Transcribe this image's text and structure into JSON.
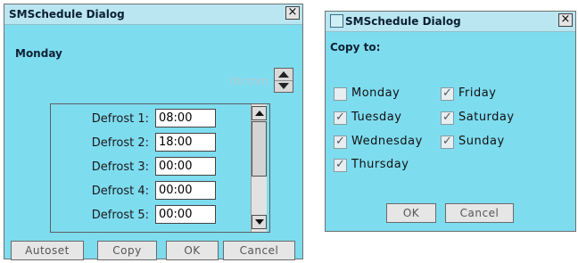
{
  "dialog1": {
    "title": "SMSchedule Dialog",
    "close_glyph": "×",
    "heading": "Monday",
    "time_format_hint": "hh:mm",
    "rows": [
      {
        "label": "Defrost 1:",
        "value": "08:00"
      },
      {
        "label": "Defrost 2:",
        "value": "18:00"
      },
      {
        "label": "Defrost 3:",
        "value": "00:00"
      },
      {
        "label": "Defrost 4:",
        "value": "00:00"
      },
      {
        "label": "Defrost 5:",
        "value": "00:00"
      }
    ],
    "buttons": {
      "autoset": "Autoset",
      "copy": "Copy",
      "ok": "OK",
      "cancel": "Cancel"
    }
  },
  "dialog2": {
    "title": "SMSchedule Dialog",
    "close_glyph": "×",
    "heading": "Copy to:",
    "days": [
      {
        "label": "Monday",
        "checked": false
      },
      {
        "label": "Tuesday",
        "checked": true
      },
      {
        "label": "Wednesday",
        "checked": true
      },
      {
        "label": "Thursday",
        "checked": true
      },
      {
        "label": "Friday",
        "checked": true
      },
      {
        "label": "Saturday",
        "checked": true
      },
      {
        "label": "Sunday",
        "checked": true
      }
    ],
    "buttons": {
      "ok": "OK",
      "cancel": "Cancel"
    }
  },
  "colors": {
    "dialog_bg": "#7edcef",
    "titlebar_bg": "#b9e6f1"
  }
}
